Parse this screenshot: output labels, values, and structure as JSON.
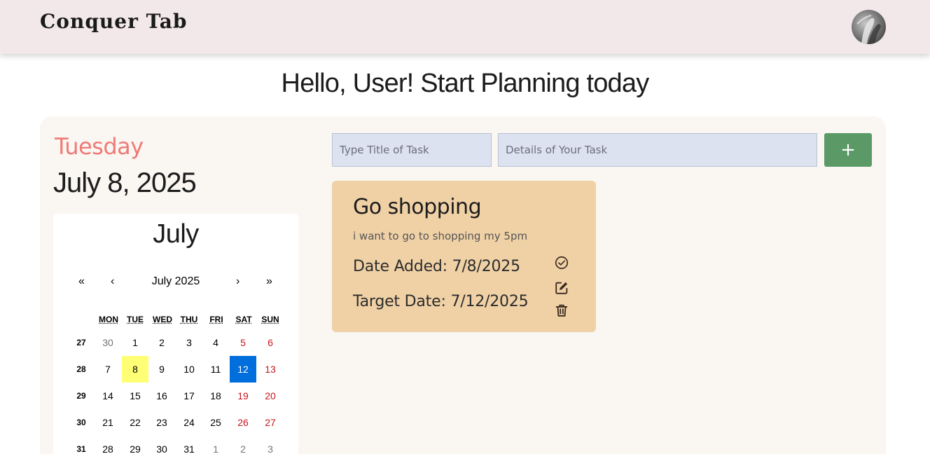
{
  "header": {
    "logo": "Conquer Tab",
    "avatar_icon": "user-avatar"
  },
  "greeting": "Hello, User! Start Planning today",
  "today": {
    "day_name": "Tuesday",
    "full_date": "July 8, 2025"
  },
  "calendar": {
    "month_title": "July",
    "nav": {
      "prev_year": "«",
      "prev_month": "‹",
      "label": "July 2025",
      "next_month": "›",
      "next_year": "»"
    },
    "weekdays": [
      "MON",
      "TUE",
      "WED",
      "THU",
      "FRI",
      "SAT",
      "SUN"
    ],
    "weeks": [
      {
        "number": "27",
        "days": [
          "30",
          "1",
          "2",
          "3",
          "4",
          "5",
          "6"
        ]
      },
      {
        "number": "28",
        "days": [
          "7",
          "8",
          "9",
          "10",
          "11",
          "12",
          "13"
        ]
      },
      {
        "number": "29",
        "days": [
          "14",
          "15",
          "16",
          "17",
          "18",
          "19",
          "20"
        ]
      },
      {
        "number": "30",
        "days": [
          "21",
          "22",
          "23",
          "24",
          "25",
          "26",
          "27"
        ]
      },
      {
        "number": "31",
        "days": [
          "28",
          "29",
          "30",
          "31",
          "1",
          "2",
          "3"
        ]
      }
    ],
    "today_day": "8",
    "selected_day": "12",
    "colors": {
      "today": "#ffff76",
      "selected": "#006edc",
      "weekend": "#c8161d"
    }
  },
  "form": {
    "title_placeholder": "Type Title of Task",
    "details_placeholder": "Details of Your Task",
    "add_label": "+"
  },
  "task": {
    "title": "Go shopping",
    "details": "i want to go to shopping my 5pm",
    "date_added": "Date Added: 7/8/2025",
    "target_date": "Target Date: 7/12/2025",
    "icons": [
      "check-circle-icon",
      "edit-icon",
      "trash-icon"
    ]
  },
  "colors": {
    "header_bg": "#f2e8ea",
    "panel_bg": "#faf6f2",
    "day_name": "#f07a76",
    "card_bg": "#f0d1a6",
    "add_button": "#5b9a67",
    "input_bg": "#dce2ef"
  }
}
